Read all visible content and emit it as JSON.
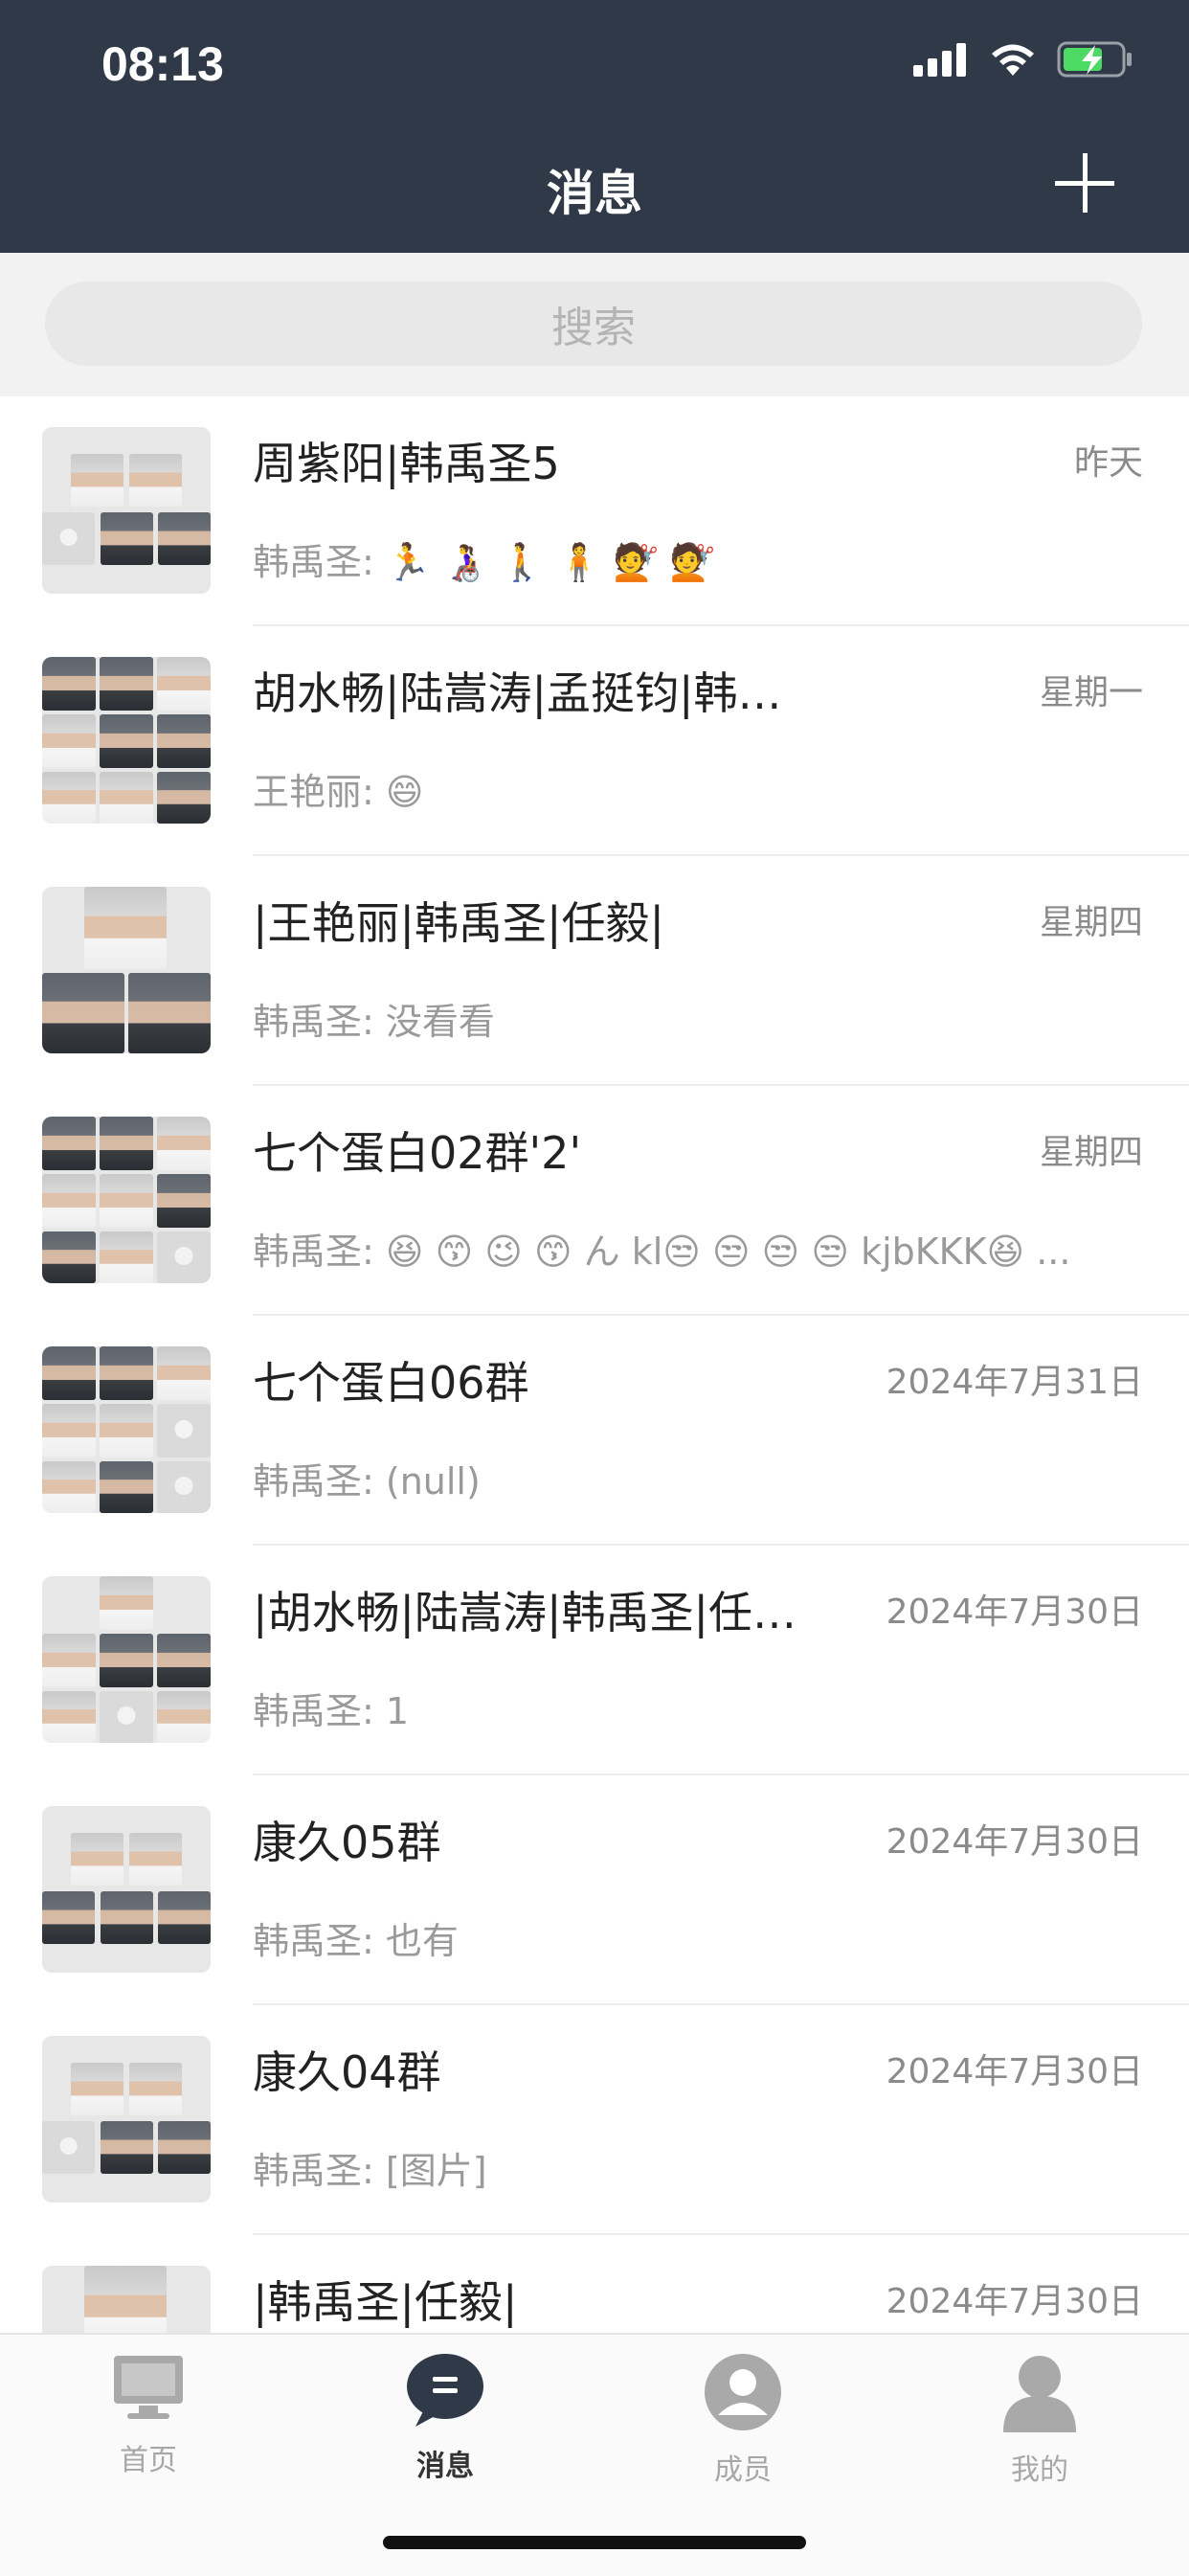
{
  "status_bar": {
    "time": "08:13"
  },
  "header": {
    "title": "消息"
  },
  "search": {
    "placeholder": "搜索"
  },
  "conversations": [
    {
      "name": "周紫阳|韩禹圣5",
      "time": "昨天",
      "preview": "韩禹圣: 🏃 👩‍🦽 🚶 🧍 💇 💇"
    },
    {
      "name": "胡水畅|陆嵩涛|孟挺钧|韩…",
      "time": "星期一",
      "preview": "王艳丽: 😄"
    },
    {
      "name": "|王艳丽|韩禹圣|任毅|",
      "time": "星期四",
      "preview": "韩禹圣: 没看看"
    },
    {
      "name": "七个蛋白02群'2'",
      "time": "星期四",
      "preview": "韩禹圣: 😆 😙 😉 😙 ん kl😒 😒 😒 😒 kjbKKK😆 ..."
    },
    {
      "name": "七个蛋白06群",
      "time": "2024年7月31日",
      "preview": "韩禹圣: (null)"
    },
    {
      "name": "|胡水畅|陆嵩涛|韩禹圣|任…",
      "time": "2024年7月30日",
      "preview": "韩禹圣: 1"
    },
    {
      "name": "康久05群",
      "time": "2024年7月30日",
      "preview": "韩禹圣: 也有"
    },
    {
      "name": "康久04群",
      "time": "2024年7月30日",
      "preview": "韩禹圣: [图片]"
    },
    {
      "name": "|韩禹圣|任毅|",
      "time": "2024年7月30日",
      "preview": ""
    }
  ],
  "tabs": [
    {
      "label": "首页",
      "icon": "monitor-icon"
    },
    {
      "label": "消息",
      "icon": "chat-bubble-icon"
    },
    {
      "label": "成员",
      "icon": "member-icon"
    },
    {
      "label": "我的",
      "icon": "profile-icon"
    }
  ],
  "colors": {
    "header_bg": "#2f3947",
    "battery": "#4cd964",
    "active_tab": "#333333"
  }
}
